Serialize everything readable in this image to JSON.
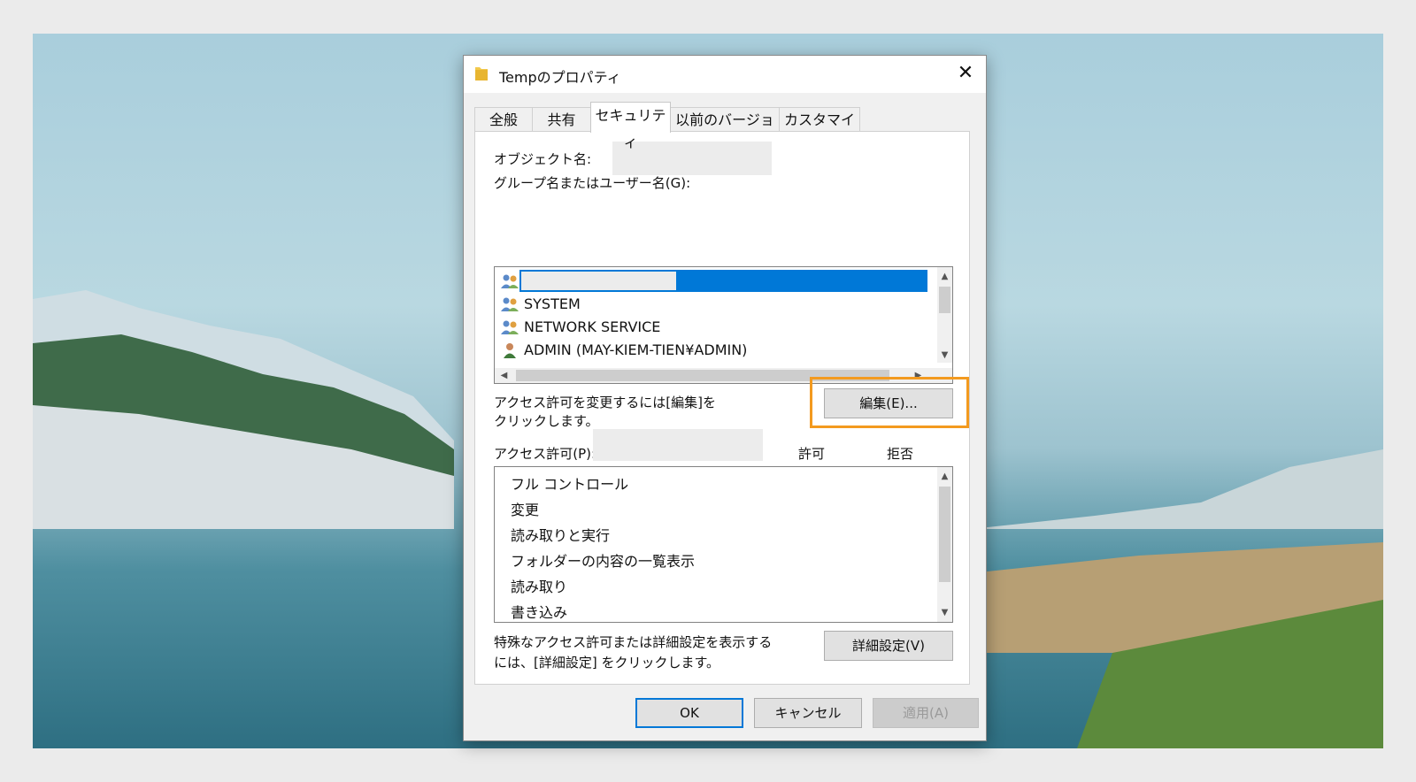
{
  "window": {
    "title": "Tempのプロパティ",
    "close_icon": "close-icon",
    "folder_icon": "folder-icon"
  },
  "tabs": [
    {
      "label": "全般",
      "active": false
    },
    {
      "label": "共有",
      "active": false
    },
    {
      "label": "セキュリティ",
      "active": true
    },
    {
      "label": "以前のバージョン",
      "active": false
    },
    {
      "label": "カスタマイズ",
      "active": false
    }
  ],
  "security": {
    "object_name_label": "オブジェクト名:",
    "groups_label": "グループ名またはユーザー名(G):",
    "users": [
      {
        "name": "",
        "icon": "user-group-icon",
        "selected": true
      },
      {
        "name": "SYSTEM",
        "icon": "user-group-icon",
        "selected": false
      },
      {
        "name": "NETWORK SERVICE",
        "icon": "user-group-icon",
        "selected": false
      },
      {
        "name": "ADMIN (MAY-KIEM-TIEN¥ADMIN)",
        "icon": "user-icon",
        "selected": false
      }
    ],
    "change_hint": "アクセス許可を変更するには[編集]を",
    "change_hint_2": "クリックします。",
    "edit_button": "編集(E)...",
    "permissions_label": "アクセス許可(P):",
    "allow_header": "許可",
    "deny_header": "拒否",
    "permissions": [
      "フル コントロール",
      "変更",
      "読み取りと実行",
      "フォルダーの内容の一覧表示",
      "読み取り",
      "書き込み"
    ],
    "advanced_hint": "特殊なアクセス許可または詳細設定を表示する",
    "advanced_hint_2": "には、[詳細設定] をクリックします。",
    "advanced_button": "詳細設定(V)"
  },
  "footer": {
    "ok": "OK",
    "cancel": "キャンセル",
    "apply": "適用(A)"
  },
  "colors": {
    "selection": "#0078d7",
    "highlight": "#f39a1f"
  }
}
